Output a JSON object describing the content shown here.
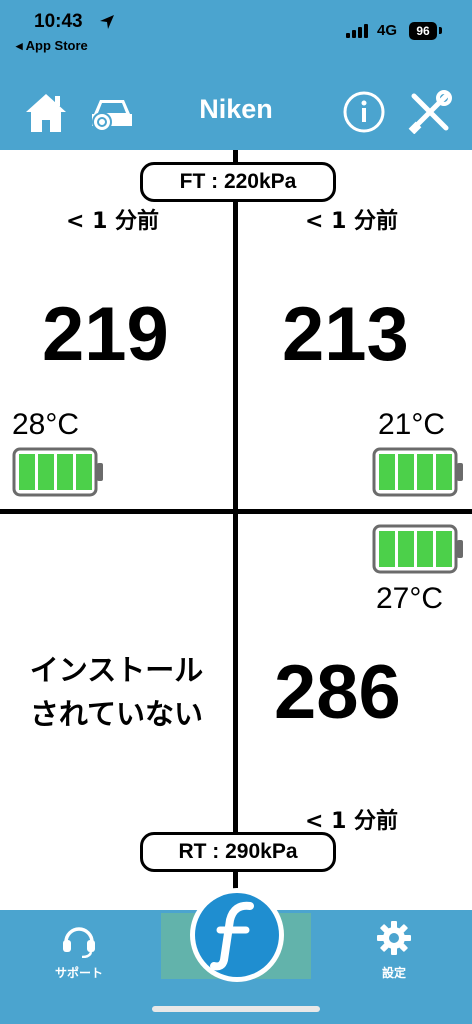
{
  "status_bar": {
    "time": "10:43",
    "back_label": "◂ App Store",
    "network": "4G",
    "battery_level": "96"
  },
  "nav": {
    "title": "Niken",
    "icons": [
      "home-icon",
      "car-tire-icon",
      "info-icon",
      "tools-icon"
    ],
    "color": "#4ba4cf"
  },
  "front": {
    "target": "FT : 220kPa",
    "left": {
      "ago": "< 1 分前",
      "pressure": "219",
      "temperature": "28°C",
      "battery_bars": 4
    },
    "right": {
      "ago": "< 1 分前",
      "pressure": "213",
      "temperature": "21°C",
      "battery_bars": 4
    }
  },
  "rear": {
    "target": "RT : 290kPa",
    "left": {
      "status_line1": "インストール",
      "status_line2": "されていない"
    },
    "right": {
      "ago": "< 1 分前",
      "pressure": "286",
      "temperature": "27°C",
      "battery_bars": 4
    }
  },
  "tabbar": {
    "support_label": "サポート",
    "settings_label": "設定",
    "center_icon": "logo-f-icon",
    "battery_color": "#4cd04a"
  }
}
